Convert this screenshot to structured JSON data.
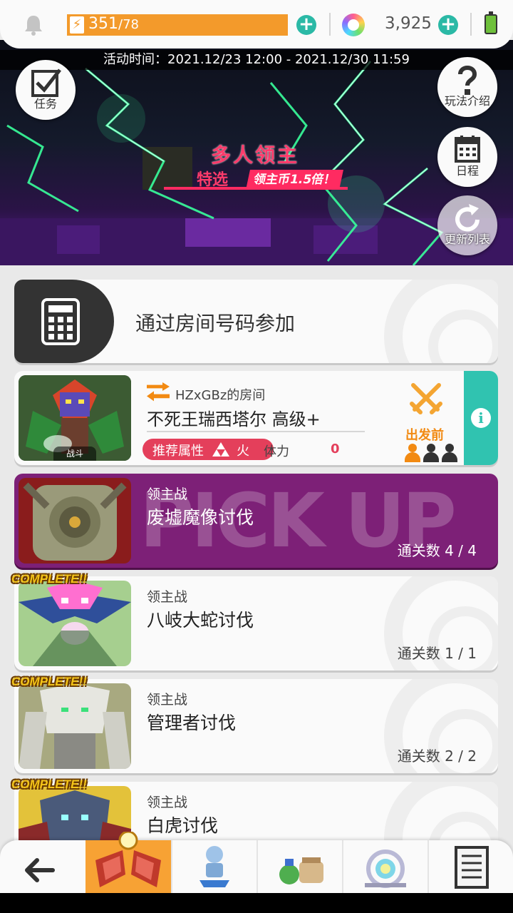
{
  "topbar": {
    "bell_icon": "bell-icon",
    "stamina_current": "351",
    "stamina_sep_max": "/78",
    "gem_count": "3,925",
    "colors": {
      "stamina": "#f39a2b",
      "accent": "#2bb9a6"
    }
  },
  "banner": {
    "event_time": "活动时间：2021.12/23 12:00 - 2021.12/30 11:59",
    "title": "多人领主",
    "featured": "特选",
    "bonus": "领主币1.5倍！",
    "buttons": {
      "mission": "任务",
      "guide": "玩法介绍",
      "schedule": "日程",
      "refresh": "更新列表"
    }
  },
  "join": {
    "label": "通过房间号码参加"
  },
  "room": {
    "thumb_tag": "战斗",
    "room_name": "HZxGBz的房间",
    "boss": "不死王瑞西塔尔 高级+",
    "attr_label": "推荐属性",
    "attr_value": "火",
    "stamina_label": "体力",
    "stamina_value": "0",
    "status": "出发前",
    "players_joined": 1,
    "players_total": 3
  },
  "bosses": [
    {
      "type": "领主战",
      "name": "废墟魔像讨伐",
      "clears": "通关数 4 / 4",
      "pickup": "PICK UP",
      "complete": ""
    },
    {
      "type": "领主战",
      "name": "八岐大蛇讨伐",
      "clears": "通关数 1 / 1",
      "complete": "COMPLETE!!"
    },
    {
      "type": "领主战",
      "name": "管理者讨伐",
      "clears": "通关数 2 / 2",
      "complete": "COMPLETE!!"
    },
    {
      "type": "领主战",
      "name": "白虎讨伐",
      "clears": "",
      "complete": "COMPLETE!!"
    }
  ],
  "bottom_nav": {
    "back_icon": "back-arrow-icon",
    "tabs": [
      "boss-battle-icon",
      "character-icon",
      "items-icon",
      "summon-icon",
      "list-icon"
    ]
  }
}
